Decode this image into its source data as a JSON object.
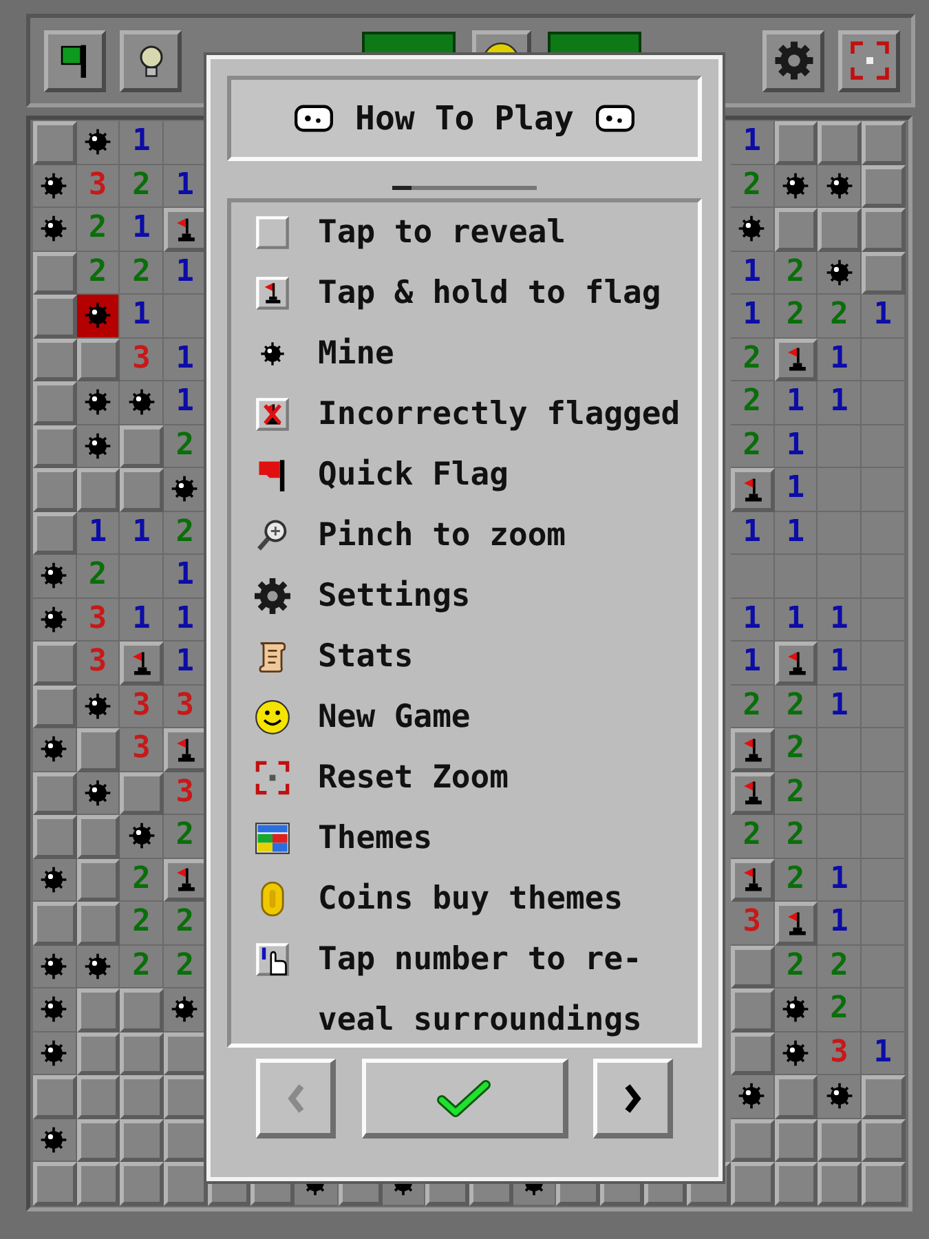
{
  "board": {
    "rows": [
      {
        "left": [
          {
            "kind": "covered"
          },
          {
            "kind": "mine"
          },
          {
            "kind": "number",
            "text": "1",
            "color": "#0c0ca8"
          },
          {
            "kind": "empty"
          }
        ],
        "right": [
          {
            "kind": "number",
            "text": "1",
            "color": "#0c0ca8"
          },
          {
            "kind": "covered"
          },
          {
            "kind": "covered"
          },
          {
            "kind": "covered"
          }
        ]
      },
      {
        "left": [
          {
            "kind": "mine"
          },
          {
            "kind": "number",
            "text": "3",
            "color": "#c81818"
          },
          {
            "kind": "number",
            "text": "2",
            "color": "#0a6e0a"
          },
          {
            "kind": "number",
            "text": "1",
            "color": "#0c0ca8"
          }
        ],
        "right": [
          {
            "kind": "number",
            "text": "2",
            "color": "#0a6e0a"
          },
          {
            "kind": "mine"
          },
          {
            "kind": "mine"
          },
          {
            "kind": "covered"
          }
        ]
      },
      {
        "left": [
          {
            "kind": "mine"
          },
          {
            "kind": "number",
            "text": "2",
            "color": "#0a6e0a"
          },
          {
            "kind": "number",
            "text": "1",
            "color": "#0c0ca8"
          },
          {
            "kind": "flag"
          }
        ],
        "right": [
          {
            "kind": "mine"
          },
          {
            "kind": "covered"
          },
          {
            "kind": "covered"
          },
          {
            "kind": "covered"
          }
        ]
      },
      {
        "left": [
          {
            "kind": "covered"
          },
          {
            "kind": "number",
            "text": "2",
            "color": "#0a6e0a"
          },
          {
            "kind": "number",
            "text": "2",
            "color": "#0a6e0a"
          },
          {
            "kind": "number",
            "text": "1",
            "color": "#0c0ca8"
          }
        ],
        "right": [
          {
            "kind": "number",
            "text": "1",
            "color": "#0c0ca8"
          },
          {
            "kind": "number",
            "text": "2",
            "color": "#0a6e0a"
          },
          {
            "kind": "mine"
          },
          {
            "kind": "covered"
          }
        ]
      },
      {
        "left": [
          {
            "kind": "covered"
          },
          {
            "kind": "exploded"
          },
          {
            "kind": "number",
            "text": "1",
            "color": "#0c0ca8"
          },
          {
            "kind": "empty"
          }
        ],
        "right": [
          {
            "kind": "number",
            "text": "1",
            "color": "#0c0ca8"
          },
          {
            "kind": "number",
            "text": "2",
            "color": "#0a6e0a"
          },
          {
            "kind": "number",
            "text": "2",
            "color": "#0a6e0a"
          },
          {
            "kind": "number",
            "text": "1",
            "color": "#0c0ca8"
          }
        ]
      },
      {
        "left": [
          {
            "kind": "covered"
          },
          {
            "kind": "covered"
          },
          {
            "kind": "number",
            "text": "3",
            "color": "#c81818"
          },
          {
            "kind": "number",
            "text": "1",
            "color": "#0c0ca8"
          }
        ],
        "right": [
          {
            "kind": "number",
            "text": "2",
            "color": "#0a6e0a"
          },
          {
            "kind": "flag"
          },
          {
            "kind": "number",
            "text": "1",
            "color": "#0c0ca8"
          },
          {
            "kind": "empty"
          }
        ]
      },
      {
        "left": [
          {
            "kind": "covered"
          },
          {
            "kind": "mine"
          },
          {
            "kind": "mine"
          },
          {
            "kind": "number",
            "text": "1",
            "color": "#0c0ca8"
          }
        ],
        "right": [
          {
            "kind": "number",
            "text": "2",
            "color": "#0a6e0a"
          },
          {
            "kind": "number",
            "text": "1",
            "color": "#0c0ca8"
          },
          {
            "kind": "number",
            "text": "1",
            "color": "#0c0ca8"
          },
          {
            "kind": "empty"
          }
        ]
      },
      {
        "left": [
          {
            "kind": "covered"
          },
          {
            "kind": "mine"
          },
          {
            "kind": "covered"
          },
          {
            "kind": "number",
            "text": "2",
            "color": "#0a6e0a"
          }
        ],
        "right": [
          {
            "kind": "number",
            "text": "2",
            "color": "#0a6e0a"
          },
          {
            "kind": "number",
            "text": "1",
            "color": "#0c0ca8"
          },
          {
            "kind": "empty"
          },
          {
            "kind": "empty"
          }
        ]
      },
      {
        "left": [
          {
            "kind": "covered"
          },
          {
            "kind": "covered"
          },
          {
            "kind": "covered"
          },
          {
            "kind": "mine"
          }
        ],
        "right": [
          {
            "kind": "flag"
          },
          {
            "kind": "number",
            "text": "1",
            "color": "#0c0ca8"
          },
          {
            "kind": "empty"
          },
          {
            "kind": "empty"
          }
        ]
      },
      {
        "left": [
          {
            "kind": "covered"
          },
          {
            "kind": "number",
            "text": "1",
            "color": "#0c0ca8"
          },
          {
            "kind": "number",
            "text": "1",
            "color": "#0c0ca8"
          },
          {
            "kind": "number",
            "text": "2",
            "color": "#0a6e0a"
          }
        ],
        "right": [
          {
            "kind": "number",
            "text": "1",
            "color": "#0c0ca8"
          },
          {
            "kind": "number",
            "text": "1",
            "color": "#0c0ca8"
          },
          {
            "kind": "empty"
          },
          {
            "kind": "empty"
          }
        ]
      },
      {
        "left": [
          {
            "kind": "mine"
          },
          {
            "kind": "number",
            "text": "2",
            "color": "#0a6e0a"
          },
          {
            "kind": "empty"
          },
          {
            "kind": "number",
            "text": "1",
            "color": "#0c0ca8"
          }
        ],
        "right": [
          {
            "kind": "empty"
          },
          {
            "kind": "empty"
          },
          {
            "kind": "empty"
          },
          {
            "kind": "empty"
          }
        ]
      },
      {
        "left": [
          {
            "kind": "mine"
          },
          {
            "kind": "number",
            "text": "3",
            "color": "#c81818"
          },
          {
            "kind": "number",
            "text": "1",
            "color": "#0c0ca8"
          },
          {
            "kind": "number",
            "text": "1",
            "color": "#0c0ca8"
          }
        ],
        "right": [
          {
            "kind": "number",
            "text": "1",
            "color": "#0c0ca8"
          },
          {
            "kind": "number",
            "text": "1",
            "color": "#0c0ca8"
          },
          {
            "kind": "number",
            "text": "1",
            "color": "#0c0ca8"
          },
          {
            "kind": "empty"
          }
        ]
      },
      {
        "left": [
          {
            "kind": "covered"
          },
          {
            "kind": "number",
            "text": "3",
            "color": "#c81818"
          },
          {
            "kind": "flag"
          },
          {
            "kind": "number",
            "text": "1",
            "color": "#0c0ca8"
          }
        ],
        "right": [
          {
            "kind": "number",
            "text": "1",
            "color": "#0c0ca8"
          },
          {
            "kind": "flag"
          },
          {
            "kind": "number",
            "text": "1",
            "color": "#0c0ca8"
          },
          {
            "kind": "empty"
          }
        ]
      },
      {
        "left": [
          {
            "kind": "covered"
          },
          {
            "kind": "mine"
          },
          {
            "kind": "number",
            "text": "3",
            "color": "#c81818"
          },
          {
            "kind": "number",
            "text": "3",
            "color": "#c81818"
          }
        ],
        "right": [
          {
            "kind": "number",
            "text": "2",
            "color": "#0a6e0a"
          },
          {
            "kind": "number",
            "text": "2",
            "color": "#0a6e0a"
          },
          {
            "kind": "number",
            "text": "1",
            "color": "#0c0ca8"
          },
          {
            "kind": "empty"
          }
        ]
      },
      {
        "left": [
          {
            "kind": "mine"
          },
          {
            "kind": "covered"
          },
          {
            "kind": "number",
            "text": "3",
            "color": "#c81818"
          },
          {
            "kind": "flag"
          }
        ],
        "right": [
          {
            "kind": "flag"
          },
          {
            "kind": "number",
            "text": "2",
            "color": "#0a6e0a"
          },
          {
            "kind": "empty"
          },
          {
            "kind": "empty"
          }
        ]
      },
      {
        "left": [
          {
            "kind": "covered"
          },
          {
            "kind": "mine"
          },
          {
            "kind": "covered"
          },
          {
            "kind": "number",
            "text": "3",
            "color": "#c81818"
          }
        ],
        "right": [
          {
            "kind": "flag"
          },
          {
            "kind": "number",
            "text": "2",
            "color": "#0a6e0a"
          },
          {
            "kind": "empty"
          },
          {
            "kind": "empty"
          }
        ]
      },
      {
        "left": [
          {
            "kind": "covered"
          },
          {
            "kind": "covered"
          },
          {
            "kind": "mine"
          },
          {
            "kind": "number",
            "text": "2",
            "color": "#0a6e0a"
          }
        ],
        "right": [
          {
            "kind": "number",
            "text": "2",
            "color": "#0a6e0a"
          },
          {
            "kind": "number",
            "text": "2",
            "color": "#0a6e0a"
          },
          {
            "kind": "empty"
          },
          {
            "kind": "empty"
          }
        ]
      },
      {
        "left": [
          {
            "kind": "mine"
          },
          {
            "kind": "covered"
          },
          {
            "kind": "number",
            "text": "2",
            "color": "#0a6e0a"
          },
          {
            "kind": "flag"
          }
        ],
        "right": [
          {
            "kind": "flag"
          },
          {
            "kind": "number",
            "text": "2",
            "color": "#0a6e0a"
          },
          {
            "kind": "number",
            "text": "1",
            "color": "#0c0ca8"
          },
          {
            "kind": "empty"
          }
        ]
      },
      {
        "left": [
          {
            "kind": "covered"
          },
          {
            "kind": "covered"
          },
          {
            "kind": "number",
            "text": "2",
            "color": "#0a6e0a"
          },
          {
            "kind": "number",
            "text": "2",
            "color": "#0a6e0a"
          }
        ],
        "right": [
          {
            "kind": "number",
            "text": "3",
            "color": "#c81818"
          },
          {
            "kind": "flag"
          },
          {
            "kind": "number",
            "text": "1",
            "color": "#0c0ca8"
          },
          {
            "kind": "empty"
          }
        ]
      },
      {
        "left": [
          {
            "kind": "mine"
          },
          {
            "kind": "mine"
          },
          {
            "kind": "number",
            "text": "2",
            "color": "#0a6e0a"
          },
          {
            "kind": "number",
            "text": "2",
            "color": "#0a6e0a"
          }
        ],
        "right": [
          {
            "kind": "covered"
          },
          {
            "kind": "number",
            "text": "2",
            "color": "#0a6e0a"
          },
          {
            "kind": "number",
            "text": "2",
            "color": "#0a6e0a"
          },
          {
            "kind": "empty"
          }
        ]
      },
      {
        "left": [
          {
            "kind": "mine"
          },
          {
            "kind": "covered"
          },
          {
            "kind": "covered"
          },
          {
            "kind": "mine"
          }
        ],
        "right": [
          {
            "kind": "covered"
          },
          {
            "kind": "mine"
          },
          {
            "kind": "number",
            "text": "2",
            "color": "#0a6e0a"
          },
          {
            "kind": "empty"
          }
        ]
      },
      {
        "left": [
          {
            "kind": "mine"
          },
          {
            "kind": "covered"
          },
          {
            "kind": "covered"
          },
          {
            "kind": "covered"
          }
        ],
        "right": [
          {
            "kind": "covered"
          },
          {
            "kind": "mine"
          },
          {
            "kind": "number",
            "text": "3",
            "color": "#c81818"
          },
          {
            "kind": "number",
            "text": "1",
            "color": "#0c0ca8"
          }
        ]
      },
      {
        "left": [
          {
            "kind": "covered"
          },
          {
            "kind": "covered"
          },
          {
            "kind": "covered"
          },
          {
            "kind": "covered"
          }
        ],
        "right": [
          {
            "kind": "mine"
          },
          {
            "kind": "covered"
          },
          {
            "kind": "mine"
          },
          {
            "kind": "covered"
          }
        ]
      },
      {
        "left": [
          {
            "kind": "mine"
          },
          {
            "kind": "covered"
          },
          {
            "kind": "covered"
          },
          {
            "kind": "covered"
          }
        ],
        "right": [
          {
            "kind": "covered"
          },
          {
            "kind": "covered"
          },
          {
            "kind": "covered"
          },
          {
            "kind": "covered"
          }
        ]
      },
      {
        "cells": [
          {
            "kind": "covered"
          },
          {
            "kind": "covered"
          },
          {
            "kind": "covered"
          },
          {
            "kind": "covered"
          },
          {
            "kind": "covered"
          },
          {
            "kind": "covered"
          },
          {
            "kind": "mine"
          },
          {
            "kind": "covered"
          },
          {
            "kind": "mine"
          },
          {
            "kind": "covered"
          },
          {
            "kind": "covered"
          },
          {
            "kind": "mine"
          },
          {
            "kind": "covered"
          },
          {
            "kind": "covered"
          },
          {
            "kind": "covered"
          },
          {
            "kind": "covered"
          },
          {
            "kind": "covered"
          },
          {
            "kind": "covered"
          },
          {
            "kind": "covered"
          },
          {
            "kind": "covered"
          }
        ]
      }
    ]
  },
  "dialog": {
    "title": "How To Play",
    "items": [
      {
        "kind": "reveal",
        "text": "Tap to reveal"
      },
      {
        "kind": "flag_tile",
        "text": "Tap & hold to flag"
      },
      {
        "kind": "mine",
        "text": "Mine"
      },
      {
        "kind": "wrong_flag",
        "text": "Incorrectly flagged"
      },
      {
        "kind": "quick_flag",
        "text": "Quick Flag"
      },
      {
        "kind": "zoom",
        "text": "Pinch to zoom"
      },
      {
        "kind": "settings",
        "text": "Settings"
      },
      {
        "kind": "stats",
        "text": "Stats"
      },
      {
        "kind": "new_game",
        "text": "New Game"
      },
      {
        "kind": "reset_zoom",
        "text": "Reset Zoom"
      },
      {
        "kind": "themes",
        "text": "Themes"
      },
      {
        "kind": "coins",
        "text": "Coins buy themes"
      },
      {
        "kind": "tap_number",
        "text": "Tap number to re-veal surroundings"
      }
    ],
    "buttons": [
      {
        "kind": "prev",
        "disabled": true
      },
      {
        "kind": "ok",
        "disabled": false
      },
      {
        "kind": "next",
        "disabled": false
      }
    ]
  }
}
